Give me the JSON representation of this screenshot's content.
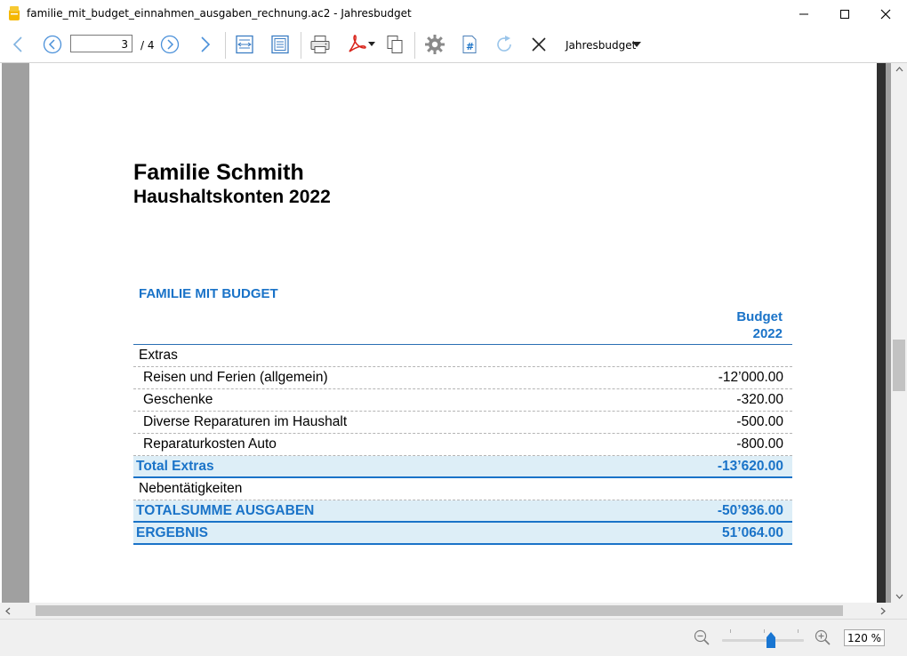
{
  "window": {
    "title": "familie_mit_budget_einnahmen_ausgaben_rechnung.ac2 - Jahresbudget"
  },
  "toolbar": {
    "page_current": "3",
    "page_total": "/ 4",
    "report_dropdown": "Jahresbudget",
    "icons": [
      "back-icon",
      "previous-page-icon",
      "next-page-icon",
      "forward-icon",
      "fit-width-icon",
      "fit-page-icon",
      "print-icon",
      "pdf-icon",
      "copy-icon",
      "settings-icon",
      "page-number-icon",
      "refresh-icon",
      "close-icon"
    ]
  },
  "document": {
    "title": "Familie Schmith",
    "subtitle": "Haushaltskonten 2022",
    "section_heading": "FAMILIE MIT BUDGET",
    "column_header_line1": "Budget",
    "column_header_line2": "2022",
    "rows": [
      {
        "label": "Extras",
        "amount": "",
        "kind": "group"
      },
      {
        "label": "Reisen und Ferien (allgemein)",
        "amount": "-12’000.00",
        "kind": "item"
      },
      {
        "label": "Geschenke",
        "amount": "-320.00",
        "kind": "item"
      },
      {
        "label": "Diverse Reparaturen im Haushalt",
        "amount": "-500.00",
        "kind": "item"
      },
      {
        "label": "Reparaturkosten Auto",
        "amount": "-800.00",
        "kind": "item"
      },
      {
        "label": "Total Extras",
        "amount": "-13’620.00",
        "kind": "total"
      },
      {
        "label": "Nebentätigkeiten",
        "amount": "",
        "kind": "group"
      },
      {
        "label": "TOTALSUMME AUSGABEN",
        "amount": "-50’936.00",
        "kind": "total"
      },
      {
        "label": "ERGEBNIS",
        "amount": "51’064.00",
        "kind": "total"
      }
    ]
  },
  "statusbar": {
    "zoom_value": "120 %",
    "zoom_fraction": 0.6
  },
  "colors": {
    "accent_blue": "#1a73c8",
    "total_row_bg": "#ddeef7",
    "app_icon": "#f5b800",
    "pdf_red": "#d9241b",
    "zoom_thumb": "#1976d2"
  }
}
